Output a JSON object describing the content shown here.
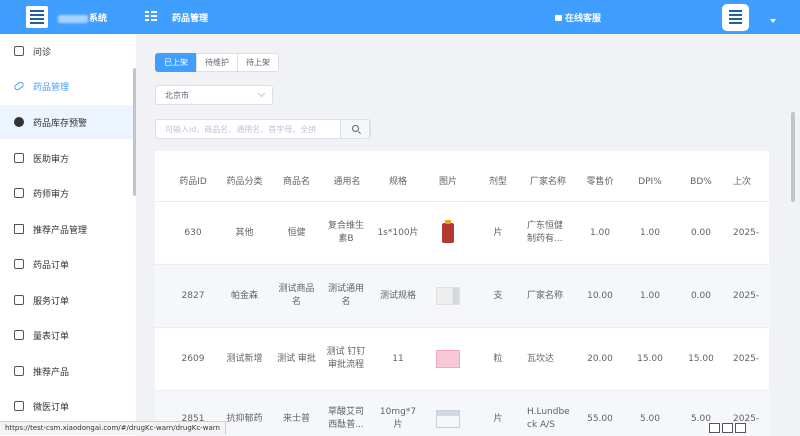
{
  "header": {
    "system_name_suffix": "系统",
    "page_title": "药品管理",
    "online_service": "在线客服"
  },
  "sidebar": {
    "items": [
      {
        "label": "问诊",
        "icon": "clinic-icon"
      },
      {
        "label": "药品管理",
        "icon": "pill-icon"
      },
      {
        "label": "药品库存预警",
        "icon": "alert-icon"
      },
      {
        "label": "医助审方",
        "icon": "tablet-icon"
      },
      {
        "label": "药师审方",
        "icon": "document-icon"
      },
      {
        "label": "推荐产品管理",
        "icon": "folder-icon"
      },
      {
        "label": "药品订单",
        "icon": "order-icon"
      },
      {
        "label": "服务订单",
        "icon": "file-icon"
      },
      {
        "label": "量表订单",
        "icon": "copy-icon"
      },
      {
        "label": "推荐产品",
        "icon": "image-icon"
      },
      {
        "label": "微医订单",
        "icon": "order2-icon"
      }
    ]
  },
  "tabs": [
    "已上架",
    "待维护",
    "待上架"
  ],
  "city_select": {
    "value": "北京市"
  },
  "search": {
    "placeholder": "可输入id、商品名、通用名、首字母、全拼"
  },
  "table": {
    "headers": [
      "药品ID",
      "药品分类",
      "商品名",
      "通用名",
      "规格",
      "图片",
      "剂型",
      "厂家名称",
      "零售价",
      "DPI%",
      "BD%",
      "上次"
    ],
    "rows": [
      {
        "id": "630",
        "category": "其他",
        "trade_name": "恒健",
        "generic_name": "复合维生素B",
        "spec": "1s*100片",
        "image": "bottle",
        "form": "片",
        "maker": "广东恒健制药有...",
        "price": "1.00",
        "dpi": "1.00",
        "bd": "0.00",
        "last": "2025-"
      },
      {
        "id": "2827",
        "category": "帕金森",
        "trade_name": "测试商品名",
        "generic_name": "测试通用名",
        "spec": "测试规格",
        "image": "box",
        "form": "支",
        "maker": "厂家名称",
        "price": "10.00",
        "dpi": "1.00",
        "bd": "0.00",
        "last": "2025-"
      },
      {
        "id": "2609",
        "category": "测试新增",
        "trade_name": "测试 审批",
        "generic_name": "测试 钉钉审批流程",
        "spec": "11",
        "image": "pink",
        "form": "粒",
        "maker": "瓦坎达",
        "price": "20.00",
        "dpi": "15.00",
        "bd": "15.00",
        "last": "2025-"
      },
      {
        "id": "2851",
        "category": "抗抑郁药",
        "trade_name": "来士普",
        "generic_name": "草酸艾司西酞普...",
        "spec": "10mg*7片",
        "image": "pack",
        "form": "片",
        "maker": "H.Lundbeck A/S",
        "price": "55.00",
        "dpi": "5.00",
        "bd": "5.00",
        "last": "2025-"
      }
    ]
  },
  "status_url": "https://test-csm.xiaodongai.com/#/drugKc-warn/drugKc-warn",
  "colors": {
    "primary": "#409eff",
    "sidebar_active_bg": "#ecf5ff"
  }
}
